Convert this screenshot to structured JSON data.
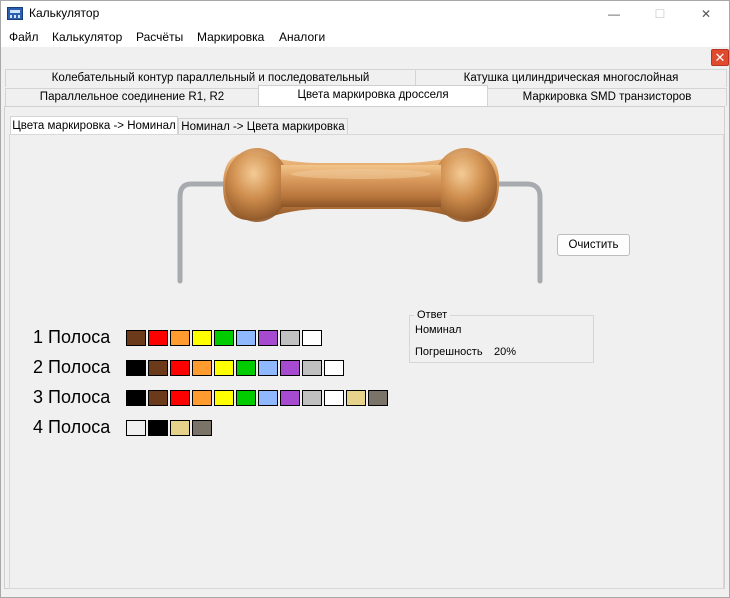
{
  "window": {
    "title": "Калькулятор",
    "icon": "calculator-icon",
    "minimize": "—",
    "maximize": "☐",
    "close": "✕"
  },
  "menu": [
    "Файл",
    "Калькулятор",
    "Расчёты",
    "Маркировка",
    "Аналоги"
  ],
  "close_panel": "✕",
  "tabs_row1": [
    "Колебательный контур параллельный и последовательный",
    "Катушка цилиндрическая многослойная"
  ],
  "tabs_row2": [
    "Параллельное соединение R1, R2",
    "Цвета маркировка дросселя",
    "Маркировка SMD транзисторов"
  ],
  "subtabs": [
    "Цвета маркировка -> Номинал",
    "Номинал -> Цвета маркировка"
  ],
  "clear_button": "Очистить",
  "bands": [
    {
      "label": "1 Полоса",
      "colors": [
        "#6b3a1a",
        "#ff0000",
        "#ff9b2f",
        "#ffff00",
        "#00cc00",
        "#8fb8ff",
        "#a64ad0",
        "#c0c0c0",
        "#ffffff"
      ]
    },
    {
      "label": "2 Полоса",
      "colors": [
        "#000000",
        "#6b3a1a",
        "#ff0000",
        "#ff9b2f",
        "#ffff00",
        "#00cc00",
        "#8fb8ff",
        "#a64ad0",
        "#c0c0c0",
        "#ffffff"
      ]
    },
    {
      "label": "3 Полоса",
      "colors": [
        "#000000",
        "#6b3a1a",
        "#ff0000",
        "#ff9b2f",
        "#ffff00",
        "#00cc00",
        "#8fb8ff",
        "#a64ad0",
        "#c0c0c0",
        "#ffffff",
        "#e6d28a",
        "#7a7468"
      ]
    },
    {
      "label": "4 Полоса",
      "colors": [
        "#f0f0f0",
        "#000000",
        "#e6d28a",
        "#7a7468"
      ]
    }
  ],
  "answer": {
    "legend": "Ответ",
    "nominal_label": "Номинал",
    "tolerance_label": "Погрешность",
    "tolerance_value": "20%"
  }
}
